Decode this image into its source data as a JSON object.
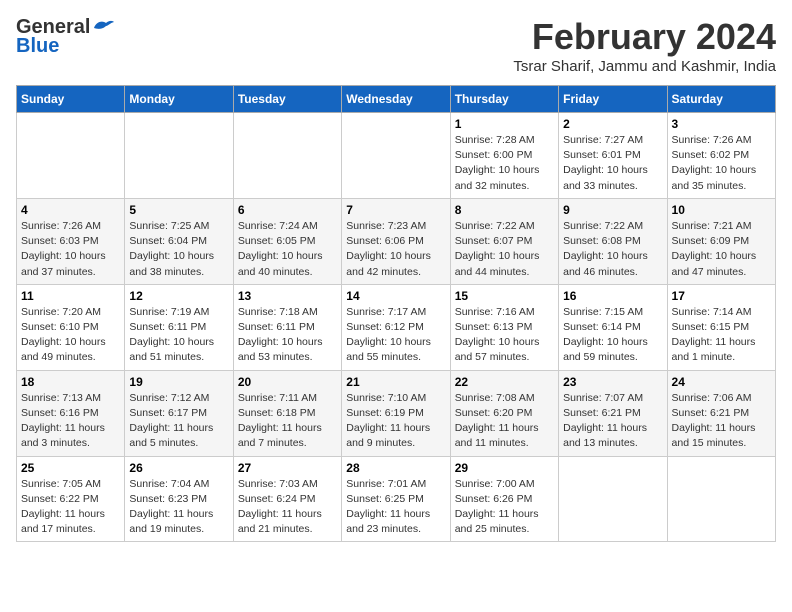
{
  "header": {
    "logo_general": "General",
    "logo_blue": "Blue",
    "month_year": "February 2024",
    "location": "Tsrar Sharif, Jammu and Kashmir, India"
  },
  "weekdays": [
    "Sunday",
    "Monday",
    "Tuesday",
    "Wednesday",
    "Thursday",
    "Friday",
    "Saturday"
  ],
  "weeks": [
    [
      {
        "day": "",
        "info": ""
      },
      {
        "day": "",
        "info": ""
      },
      {
        "day": "",
        "info": ""
      },
      {
        "day": "",
        "info": ""
      },
      {
        "day": "1",
        "info": "Sunrise: 7:28 AM\nSunset: 6:00 PM\nDaylight: 10 hours\nand 32 minutes."
      },
      {
        "day": "2",
        "info": "Sunrise: 7:27 AM\nSunset: 6:01 PM\nDaylight: 10 hours\nand 33 minutes."
      },
      {
        "day": "3",
        "info": "Sunrise: 7:26 AM\nSunset: 6:02 PM\nDaylight: 10 hours\nand 35 minutes."
      }
    ],
    [
      {
        "day": "4",
        "info": "Sunrise: 7:26 AM\nSunset: 6:03 PM\nDaylight: 10 hours\nand 37 minutes."
      },
      {
        "day": "5",
        "info": "Sunrise: 7:25 AM\nSunset: 6:04 PM\nDaylight: 10 hours\nand 38 minutes."
      },
      {
        "day": "6",
        "info": "Sunrise: 7:24 AM\nSunset: 6:05 PM\nDaylight: 10 hours\nand 40 minutes."
      },
      {
        "day": "7",
        "info": "Sunrise: 7:23 AM\nSunset: 6:06 PM\nDaylight: 10 hours\nand 42 minutes."
      },
      {
        "day": "8",
        "info": "Sunrise: 7:22 AM\nSunset: 6:07 PM\nDaylight: 10 hours\nand 44 minutes."
      },
      {
        "day": "9",
        "info": "Sunrise: 7:22 AM\nSunset: 6:08 PM\nDaylight: 10 hours\nand 46 minutes."
      },
      {
        "day": "10",
        "info": "Sunrise: 7:21 AM\nSunset: 6:09 PM\nDaylight: 10 hours\nand 47 minutes."
      }
    ],
    [
      {
        "day": "11",
        "info": "Sunrise: 7:20 AM\nSunset: 6:10 PM\nDaylight: 10 hours\nand 49 minutes."
      },
      {
        "day": "12",
        "info": "Sunrise: 7:19 AM\nSunset: 6:11 PM\nDaylight: 10 hours\nand 51 minutes."
      },
      {
        "day": "13",
        "info": "Sunrise: 7:18 AM\nSunset: 6:11 PM\nDaylight: 10 hours\nand 53 minutes."
      },
      {
        "day": "14",
        "info": "Sunrise: 7:17 AM\nSunset: 6:12 PM\nDaylight: 10 hours\nand 55 minutes."
      },
      {
        "day": "15",
        "info": "Sunrise: 7:16 AM\nSunset: 6:13 PM\nDaylight: 10 hours\nand 57 minutes."
      },
      {
        "day": "16",
        "info": "Sunrise: 7:15 AM\nSunset: 6:14 PM\nDaylight: 10 hours\nand 59 minutes."
      },
      {
        "day": "17",
        "info": "Sunrise: 7:14 AM\nSunset: 6:15 PM\nDaylight: 11 hours\nand 1 minute."
      }
    ],
    [
      {
        "day": "18",
        "info": "Sunrise: 7:13 AM\nSunset: 6:16 PM\nDaylight: 11 hours\nand 3 minutes."
      },
      {
        "day": "19",
        "info": "Sunrise: 7:12 AM\nSunset: 6:17 PM\nDaylight: 11 hours\nand 5 minutes."
      },
      {
        "day": "20",
        "info": "Sunrise: 7:11 AM\nSunset: 6:18 PM\nDaylight: 11 hours\nand 7 minutes."
      },
      {
        "day": "21",
        "info": "Sunrise: 7:10 AM\nSunset: 6:19 PM\nDaylight: 11 hours\nand 9 minutes."
      },
      {
        "day": "22",
        "info": "Sunrise: 7:08 AM\nSunset: 6:20 PM\nDaylight: 11 hours\nand 11 minutes."
      },
      {
        "day": "23",
        "info": "Sunrise: 7:07 AM\nSunset: 6:21 PM\nDaylight: 11 hours\nand 13 minutes."
      },
      {
        "day": "24",
        "info": "Sunrise: 7:06 AM\nSunset: 6:21 PM\nDaylight: 11 hours\nand 15 minutes."
      }
    ],
    [
      {
        "day": "25",
        "info": "Sunrise: 7:05 AM\nSunset: 6:22 PM\nDaylight: 11 hours\nand 17 minutes."
      },
      {
        "day": "26",
        "info": "Sunrise: 7:04 AM\nSunset: 6:23 PM\nDaylight: 11 hours\nand 19 minutes."
      },
      {
        "day": "27",
        "info": "Sunrise: 7:03 AM\nSunset: 6:24 PM\nDaylight: 11 hours\nand 21 minutes."
      },
      {
        "day": "28",
        "info": "Sunrise: 7:01 AM\nSunset: 6:25 PM\nDaylight: 11 hours\nand 23 minutes."
      },
      {
        "day": "29",
        "info": "Sunrise: 7:00 AM\nSunset: 6:26 PM\nDaylight: 11 hours\nand 25 minutes."
      },
      {
        "day": "",
        "info": ""
      },
      {
        "day": "",
        "info": ""
      }
    ]
  ]
}
